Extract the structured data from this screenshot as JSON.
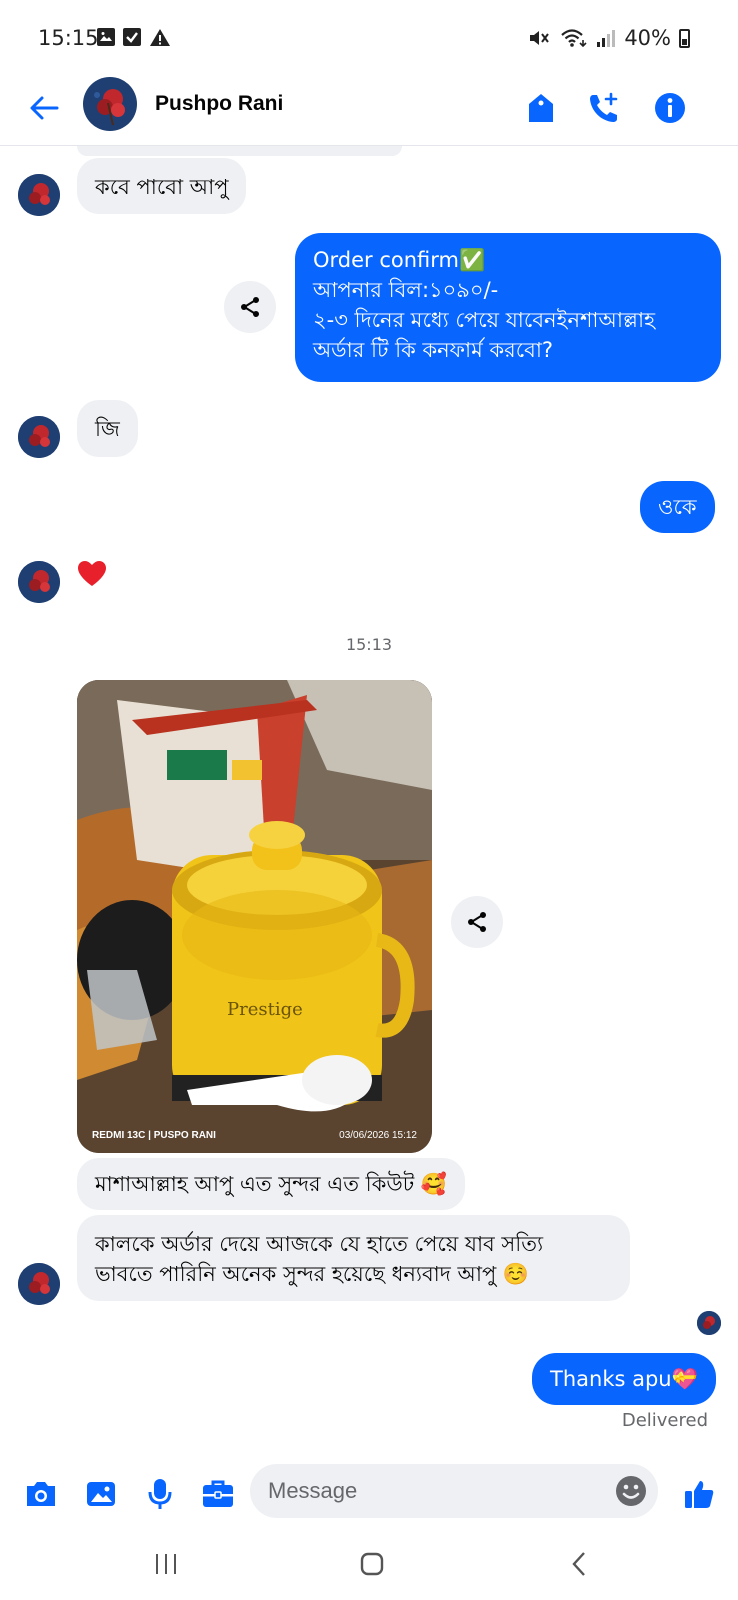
{
  "status_bar": {
    "time": "15:15",
    "battery": "40%"
  },
  "header": {
    "contact_name": "Pushpo Rani",
    "accent_color": "#0866ff"
  },
  "messages": {
    "in_1": "কবে পাবো আপু",
    "out_1_line1": "Order confirm✅",
    "out_1_line2": "আপনার বিল:১০৯০/-",
    "out_1_line3": "২-৩ দিনের মধ্যে পেয়ে যাবেনইনশাআল্লাহ",
    "out_1_line4": "অর্ডার টি কি কনফার্ম করবো?",
    "in_2": "জি",
    "out_2": "ওকে",
    "in_3_reaction": "❤️",
    "timestamp": "15:13",
    "photo_watermark_left": "REDMI 13C | PUSPO RANI",
    "photo_watermark_right": "03/06/2026 15:12",
    "in_4": "মাশাআল্লাহ আপু এত সুন্দর এত কিউট 🥰",
    "in_5_line1": "কালকে অর্ডার দেয়ে আজকে যে হাতে পেয়ে যাব সত্যি",
    "in_5_line2": "ভাবতে পারিনি অনেক সুন্দর হয়েছে ধন্যবাদ আপু ☺️",
    "out_3": "Thanks apu💝",
    "delivered": "Delivered"
  },
  "composer": {
    "placeholder": "Message"
  },
  "icons": {
    "back": "arrow-left-icon",
    "tag": "tag-icon",
    "call": "add-call-icon",
    "info": "info-icon",
    "share": "share-icon",
    "camera": "camera-icon",
    "gallery": "image-icon",
    "mic": "microphone-icon",
    "toolbox": "briefcase-icon",
    "emoji": "emoji-icon",
    "like": "thumbs-up-icon"
  }
}
